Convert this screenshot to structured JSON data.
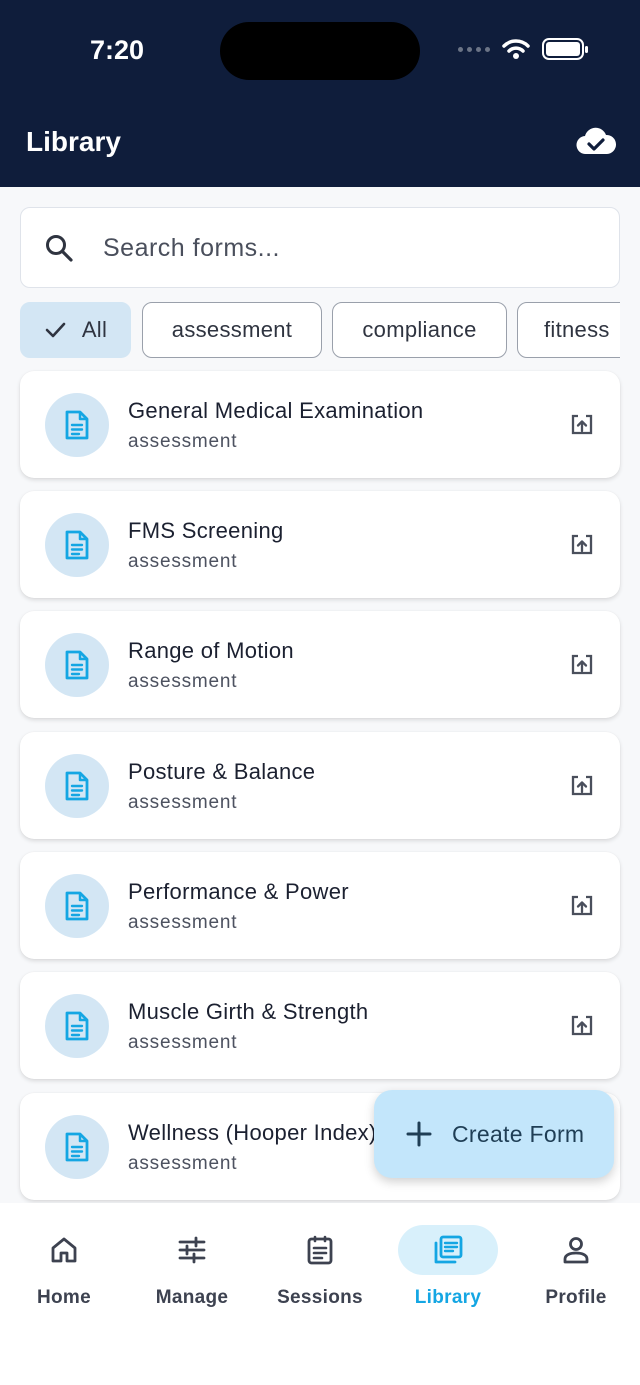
{
  "status_bar": {
    "time": "7:20"
  },
  "header": {
    "title": "Library"
  },
  "search": {
    "placeholder": "Search forms..."
  },
  "filters": [
    {
      "label": "All",
      "selected": true
    },
    {
      "label": "assessment",
      "selected": false
    },
    {
      "label": "compliance",
      "selected": false
    },
    {
      "label": "fitness",
      "selected": false
    }
  ],
  "forms": [
    {
      "title": "General Medical Examination",
      "category": "assessment"
    },
    {
      "title": "FMS Screening",
      "category": "assessment"
    },
    {
      "title": "Range of Motion",
      "category": "assessment"
    },
    {
      "title": "Posture & Balance",
      "category": "assessment"
    },
    {
      "title": "Performance & Power",
      "category": "assessment"
    },
    {
      "title": "Muscle Girth & Strength",
      "category": "assessment"
    },
    {
      "title": "Wellness (Hooper Index)",
      "category": "assessment"
    }
  ],
  "fab": {
    "label": "Create Form"
  },
  "bottom_nav": [
    {
      "label": "Home",
      "icon": "home-icon",
      "active": false
    },
    {
      "label": "Manage",
      "icon": "sliders-icon",
      "active": false
    },
    {
      "label": "Sessions",
      "icon": "clipboard-icon",
      "active": false
    },
    {
      "label": "Library",
      "icon": "library-icon",
      "active": true
    },
    {
      "label": "Profile",
      "icon": "person-icon",
      "active": false
    }
  ],
  "colors": {
    "header_bg": "#0f1d3b",
    "accent": "#14a6e3",
    "chip_selected": "#d3e6f4",
    "fab_bg": "#c3e6fb"
  }
}
